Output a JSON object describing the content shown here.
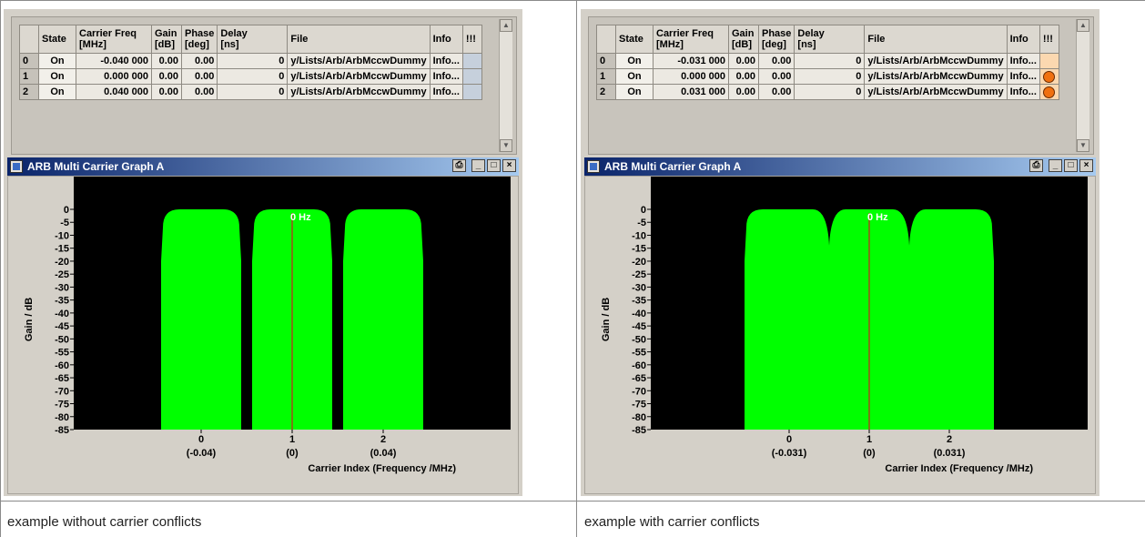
{
  "table_headers": {
    "state": "State",
    "carrier_freq_1": "Carrier Freq",
    "carrier_freq_2": "[MHz]",
    "gain_1": "Gain",
    "gain_2": "[dB]",
    "phase_1": "Phase",
    "phase_2": "[deg]",
    "delay_1": "Delay",
    "delay_2": "[ns]",
    "file": "File",
    "info": "Info",
    "conflict": "!!!"
  },
  "panels": [
    {
      "rows": [
        {
          "index": "0",
          "state": "On",
          "freq": "-0.040 000",
          "gain": "0.00",
          "phase": "0.00",
          "delay": "0",
          "file": "y/Lists/Arb/ArbMccwDummy",
          "info": "Info...",
          "conflict": false
        },
        {
          "index": "1",
          "state": "On",
          "freq": "0.000 000",
          "gain": "0.00",
          "phase": "0.00",
          "delay": "0",
          "file": "y/Lists/Arb/ArbMccwDummy",
          "info": "Info...",
          "conflict": false
        },
        {
          "index": "2",
          "state": "On",
          "freq": "0.040 000",
          "gain": "0.00",
          "phase": "0.00",
          "delay": "0",
          "file": "y/Lists/Arb/ArbMccwDummy",
          "info": "Info...",
          "conflict": false
        }
      ],
      "window_title": "ARB Multi Carrier Graph  A",
      "chart_data": {
        "type": "area",
        "title": "",
        "xlabel": "Carrier Index (Frequency /MHz)",
        "ylabel": "Gain / dB",
        "ylim": [
          -85,
          0
        ],
        "yticks": [
          "0",
          "-5",
          "-10",
          "-15",
          "-20",
          "-25",
          "-30",
          "-35",
          "-40",
          "-45",
          "-50",
          "-55",
          "-60",
          "-65",
          "-70",
          "-75",
          "-80",
          "-85"
        ],
        "center_marker": "0 Hz",
        "carrier_indices": [
          "0",
          "1",
          "2"
        ],
        "carrier_freqs": [
          "(-0.04)",
          "(0)",
          "(0.04)"
        ],
        "carrier_freq_values": [
          -0.04,
          0,
          0.04
        ],
        "series_color": "#00ff00",
        "overlapping": false
      },
      "caption": "example without carrier conflicts"
    },
    {
      "rows": [
        {
          "index": "0",
          "state": "On",
          "freq": "-0.031 000",
          "gain": "0.00",
          "phase": "0.00",
          "delay": "0",
          "file": "y/Lists/Arb/ArbMccwDummy",
          "info": "Info...",
          "conflict": false
        },
        {
          "index": "1",
          "state": "On",
          "freq": "0.000 000",
          "gain": "0.00",
          "phase": "0.00",
          "delay": "0",
          "file": "y/Lists/Arb/ArbMccwDummy",
          "info": "Info...",
          "conflict": true
        },
        {
          "index": "2",
          "state": "On",
          "freq": "0.031 000",
          "gain": "0.00",
          "phase": "0.00",
          "delay": "0",
          "file": "y/Lists/Arb/ArbMccwDummy",
          "info": "Info...",
          "conflict": true
        }
      ],
      "window_title": "ARB Multi Carrier Graph  A",
      "chart_data": {
        "type": "area",
        "title": "",
        "xlabel": "Carrier Index (Frequency /MHz)",
        "ylabel": "Gain / dB",
        "ylim": [
          -85,
          0
        ],
        "yticks": [
          "0",
          "-5",
          "-10",
          "-15",
          "-20",
          "-25",
          "-30",
          "-35",
          "-40",
          "-45",
          "-50",
          "-55",
          "-60",
          "-65",
          "-70",
          "-75",
          "-80",
          "-85"
        ],
        "center_marker": "0 Hz",
        "carrier_indices": [
          "0",
          "1",
          "2"
        ],
        "carrier_freqs": [
          "(-0.031)",
          "(0)",
          "(0.031)"
        ],
        "carrier_freq_values": [
          -0.031,
          0,
          0.031
        ],
        "series_color": "#00ff00",
        "overlapping": true
      },
      "caption": "example with carrier conflicts"
    }
  ],
  "colors": {
    "plot_background": "#000000",
    "trace": "#00ff00",
    "center_line": "#cc2020",
    "conflict_indicator": "#f07010",
    "conflict_empty": "#fbd8b0"
  }
}
